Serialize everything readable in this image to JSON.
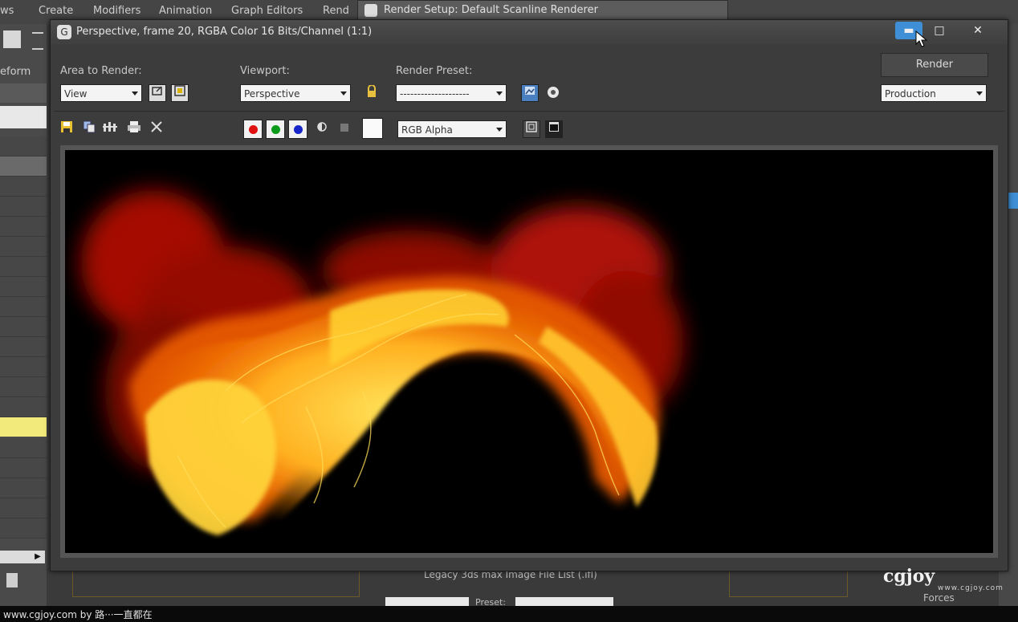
{
  "app": {
    "menu": [
      "ws",
      "Create",
      "Modifiers",
      "Animation",
      "Graph Editors",
      "Rend"
    ],
    "left_panel_label": "eform",
    "bottom_hint": "Legacy 3ds max Image File List (.ifl)",
    "bottom_forces": "Forces",
    "preset_label": "Preset:"
  },
  "render_setup": {
    "title": "Render Setup: Default Scanline Renderer"
  },
  "frame_window": {
    "title": "Perspective, frame 20, RGBA Color 16 Bits/Channel (1:1)",
    "area_label": "Area to Render:",
    "area_value": "View",
    "viewport_label": "Viewport:",
    "viewport_value": "Perspective",
    "preset_label": "Render Preset:",
    "preset_value": "--------------------",
    "render_button": "Render",
    "production_value": "Production",
    "channel_value": "RGB Alpha",
    "minimize_glyph": "▬",
    "maximize_glyph": "□",
    "close_glyph": "✕"
  },
  "channels": {
    "red": "#e01010",
    "green": "#0c9a1a",
    "blue": "#1626c8"
  },
  "icons": {
    "save": "save-icon",
    "copy": "copy-icon",
    "clone": "clone-icon",
    "print": "print-icon",
    "clear": "clear-icon"
  },
  "watermark": {
    "logo": "cgjoy",
    "url": "www.cgjoy.com"
  },
  "status": {
    "text": "www.cgjoy.com by 路···一直都在"
  }
}
